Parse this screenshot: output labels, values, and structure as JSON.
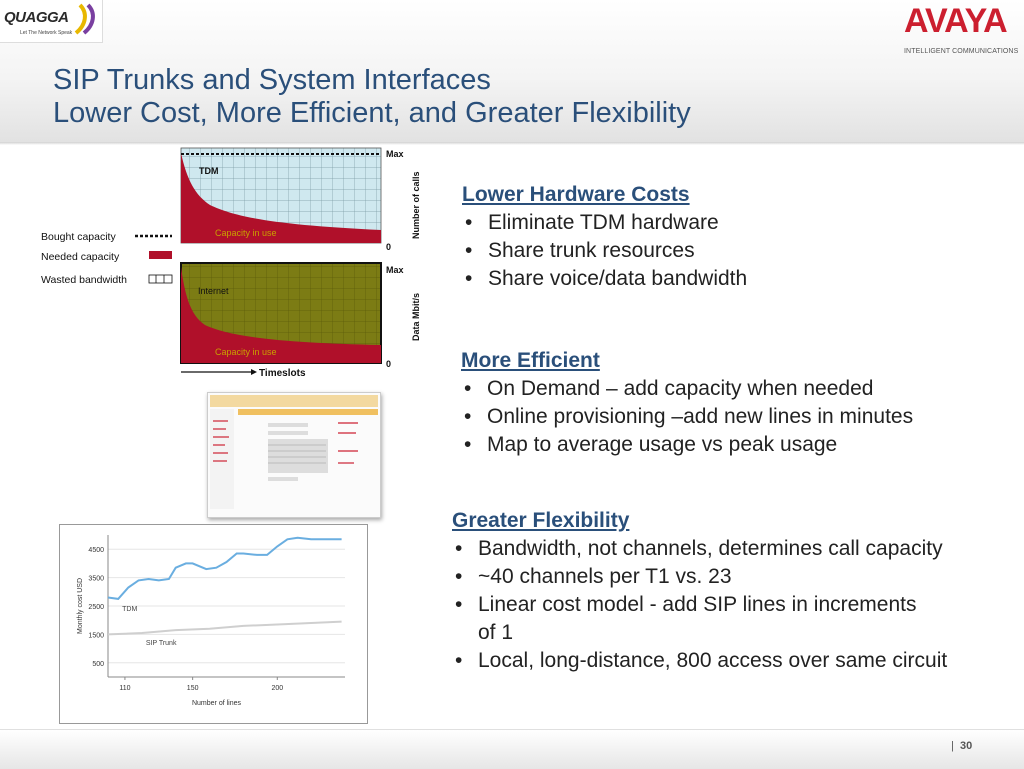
{
  "logos": {
    "quagga_name": "QUAGGA",
    "quagga_tagline": "Let The Network Speak",
    "avaya_name": "AVAYA",
    "avaya_tagline": "INTELLIGENT COMMUNICATIONS"
  },
  "title": {
    "line1": "SIP Trunks and System Interfaces",
    "line2": "Lower Cost, More Efficient, and Greater Flexibility"
  },
  "diagram": {
    "legend": [
      {
        "label": "Bought capacity",
        "swatch": "dotted-line"
      },
      {
        "label": "Needed capacity",
        "swatch": "#b0102a"
      },
      {
        "label": "Wasted bandwidth",
        "swatch": "empty-grid"
      }
    ],
    "top_panel": {
      "name": "TDM",
      "capacity_label": "Capacity in use",
      "max_label": "Max",
      "zero_label": "0",
      "axis_label": "Number of calls",
      "background": "#c8e6ee"
    },
    "bottom_panel": {
      "name": "Internet",
      "capacity_label": "Capacity in use",
      "max_label": "Max",
      "zero_label": "0",
      "axis_label": "Data Mbit/s",
      "background": "#7a7a10"
    },
    "x_axis_label": "Timeslots",
    "needed_color": "#b0102a"
  },
  "chart_data": {
    "type": "line",
    "xlabel": "Number of lines",
    "ylabel": "Monthly cost USD",
    "x_ticks": [
      "110",
      "150",
      "200"
    ],
    "y_ticks": [
      "500",
      "1500",
      "2500",
      "3500",
      "4500"
    ],
    "xlim": [
      100,
      240
    ],
    "ylim": [
      0,
      5000
    ],
    "series": [
      {
        "name": "TDM",
        "color": "#6aaee0",
        "x": [
          100,
          106,
          112,
          118,
          124,
          130,
          136,
          140,
          146,
          150,
          158,
          164,
          170,
          176,
          180,
          188,
          194,
          200,
          206,
          212,
          220,
          230,
          238
        ],
        "y": [
          2800,
          2750,
          3150,
          3400,
          3450,
          3400,
          3450,
          3850,
          4000,
          4000,
          3800,
          3850,
          4050,
          4350,
          4350,
          4300,
          4300,
          4600,
          4850,
          4900,
          4850,
          4850,
          4850
        ]
      },
      {
        "name": "SIP Trunk",
        "color": "#cfcfcf",
        "x": [
          100,
          120,
          140,
          160,
          180,
          200,
          220,
          238
        ],
        "y": [
          1500,
          1550,
          1650,
          1700,
          1800,
          1850,
          1900,
          1950
        ]
      }
    ]
  },
  "sections": [
    {
      "heading": "Lower Hardware Costs",
      "items": [
        "Eliminate TDM hardware",
        "Share trunk resources",
        "Share voice/data bandwidth"
      ]
    },
    {
      "heading": "More Efficient",
      "items": [
        "On Demand – add capacity when needed",
        "Online provisioning –add new lines in minutes",
        "Map to average usage vs peak usage"
      ]
    },
    {
      "heading": "Greater Flexibility",
      "items": [
        "Bandwidth, not channels, determines call capacity",
        "~40 channels per T1 vs. 23",
        "Linear cost model - add SIP lines in increments of 1",
        "Local, long-distance, 800 access over same circuit"
      ]
    }
  ],
  "footer": {
    "separator": "|",
    "page_number": "30"
  }
}
